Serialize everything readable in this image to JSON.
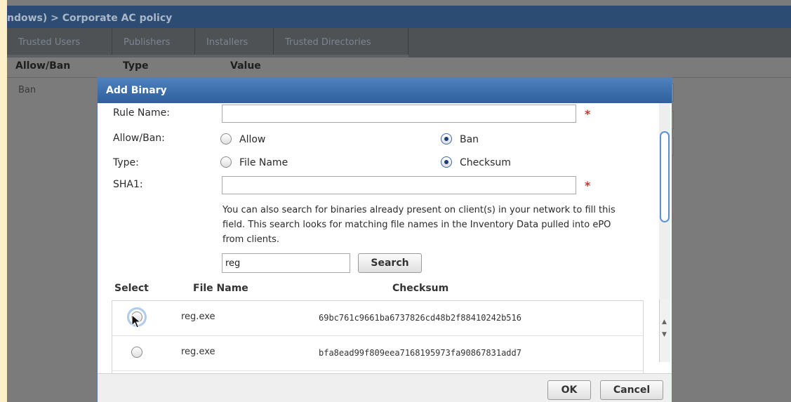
{
  "breadcrumb": "ndows) > Corporate AC policy",
  "tabs": [
    {
      "label": "Trusted Users"
    },
    {
      "label": "Publishers"
    },
    {
      "label": "Installers"
    },
    {
      "label": "Trusted Directories"
    }
  ],
  "table": {
    "headers": [
      "Allow/Ban",
      "Type",
      "Value"
    ],
    "row_value": "Ban"
  },
  "dialog": {
    "title": "Add Binary",
    "rule_name_label": "Rule Name:",
    "rule_name_value": "",
    "allow_ban_label": "Allow/Ban:",
    "allow_label": "Allow",
    "ban_label": "Ban",
    "allow_ban_selected": "Ban",
    "type_label": "Type:",
    "file_name_label": "File Name",
    "checksum_label": "Checksum",
    "type_selected": "Checksum",
    "sha1_label": "SHA1:",
    "sha1_value": "",
    "required_marker": "*",
    "help_text": "You can also search for binaries already present on client(s) in your network to fill this field. This search looks for matching file names in the Inventory Data pulled into ePO from clients.",
    "search_value": "reg",
    "search_button": "Search",
    "results": {
      "headers": [
        "Select",
        "File Name",
        "Checksum"
      ],
      "rows": [
        {
          "file_name": "reg.exe",
          "checksum": "69bc761c9661ba6737826cd48b2f88410242b516"
        },
        {
          "file_name": "reg.exe",
          "checksum": "bfa8ead99f809eea7168195973fa90867831add7"
        }
      ]
    },
    "ok_button": "OK",
    "cancel_button": "Cancel"
  },
  "colors": {
    "title_bar": "#2f5f9d",
    "crumb_bar": "#2d4c73",
    "focus": "#6ba1e3",
    "required": "#d03030"
  }
}
